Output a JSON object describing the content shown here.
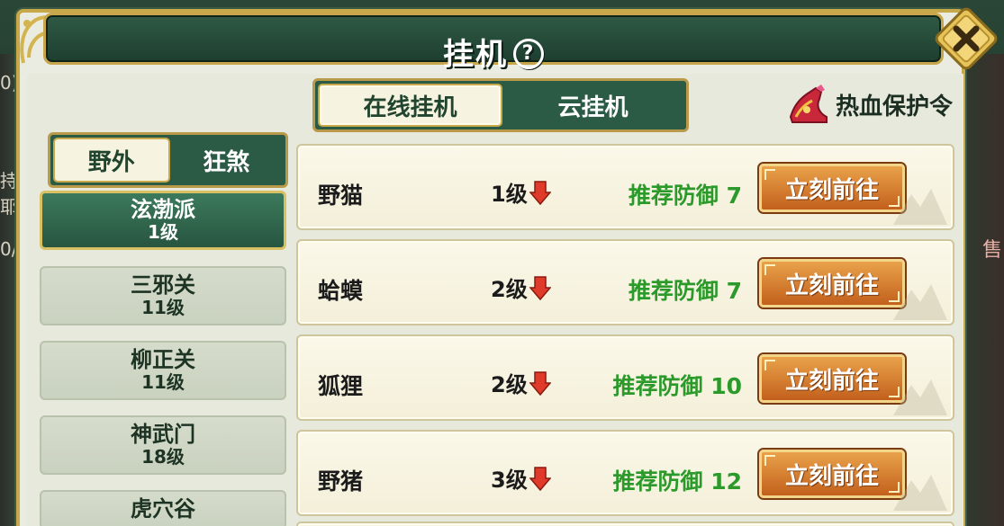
{
  "dialog": {
    "title": "挂机",
    "help_symbol": "?"
  },
  "mode_tabs": [
    {
      "label": "在线挂机",
      "active": true
    },
    {
      "label": "云挂机",
      "active": false
    }
  ],
  "protection": {
    "label": "热血保护令"
  },
  "sub_tabs": [
    {
      "label": "野外",
      "active": true
    },
    {
      "label": "狂煞",
      "active": false
    }
  ],
  "zones": [
    {
      "name": "泫渤派",
      "level": "1级",
      "active": true
    },
    {
      "name": "三邪关",
      "level": "11级",
      "active": false
    },
    {
      "name": "柳正关",
      "level": "11级",
      "active": false
    },
    {
      "name": "神武门",
      "level": "18级",
      "active": false
    },
    {
      "name": "虎穴谷",
      "level": "",
      "active": false
    }
  ],
  "monsters": [
    {
      "name": "野猫",
      "level": "1级",
      "defense": "推荐防御 7",
      "button": "立刻前往"
    },
    {
      "name": "蛤蟆",
      "level": "2级",
      "defense": "推荐防御 7",
      "button": "立刻前往"
    },
    {
      "name": "狐狸",
      "level": "2级",
      "defense": "推荐防御 10",
      "button": "立刻前往"
    },
    {
      "name": "野猪",
      "level": "3级",
      "defense": "推荐防御 12",
      "button": "立刻前往"
    }
  ],
  "backdrop": {
    "left_fragments": [
      "0)",
      "持耶",
      "0/"
    ],
    "right_fragment": "售"
  },
  "colors": {
    "panel_green": "#2b5a45",
    "gold_border": "#c8a94a",
    "defense_green": "#2b9a2a",
    "go_orange": "#d27a2e",
    "arrow_red": "#e03a2a"
  }
}
